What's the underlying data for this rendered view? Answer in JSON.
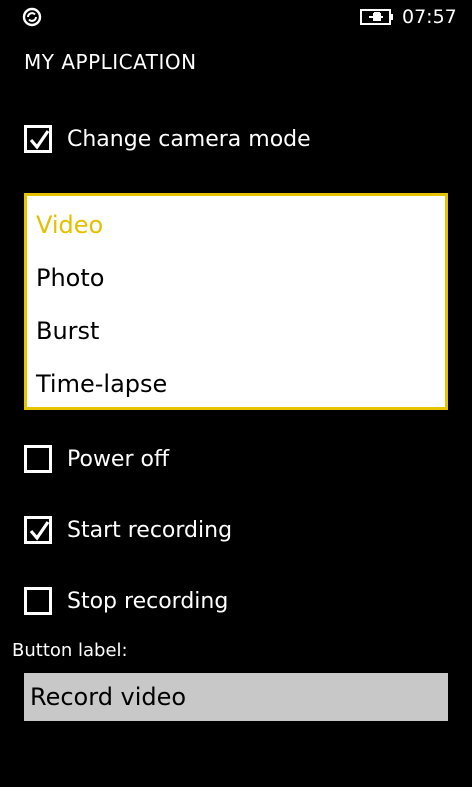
{
  "status": {
    "time": "07:57",
    "left_icon": "sync-icon",
    "battery_icon": "battery-charging-icon"
  },
  "app_title": "MY APPLICATION",
  "change_mode": {
    "label": "Change camera mode",
    "checked": true
  },
  "modes": {
    "items": [
      "Video",
      "Photo",
      "Burst",
      "Time-lapse"
    ],
    "selected": "Video",
    "accent": "#e3c000"
  },
  "options": [
    {
      "label": "Power off",
      "checked": false
    },
    {
      "label": "Start recording",
      "checked": true
    },
    {
      "label": "Stop recording",
      "checked": false
    }
  ],
  "button_label": {
    "label": "Button label:",
    "value": "Record video"
  }
}
